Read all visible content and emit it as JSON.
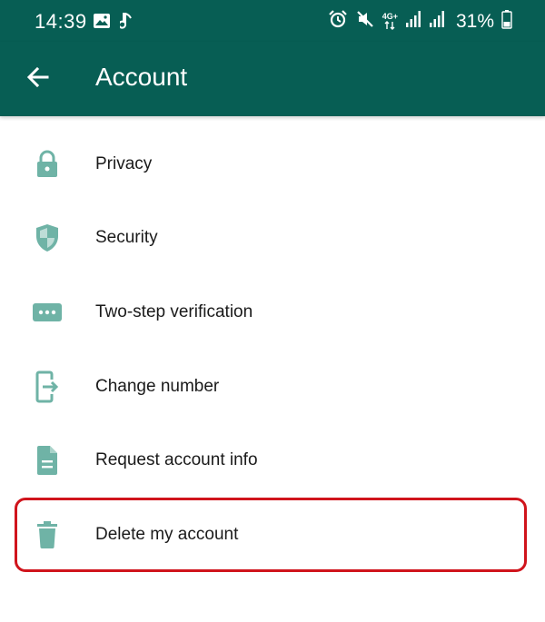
{
  "status_bar": {
    "time": "14:39",
    "network_label": "4G+",
    "battery": "31%",
    "left_icons": [
      "image-icon",
      "music-note-icon"
    ],
    "right_icons": [
      "alarm-icon",
      "mute-icon",
      "network-icon",
      "signal-icon",
      "signal-icon",
      "battery-icon"
    ]
  },
  "app_bar": {
    "title": "Account",
    "back_icon": "arrow-left-icon"
  },
  "colors": {
    "primary_dark": "#075e54",
    "icon_teal": "#6fb3a6",
    "highlight_red": "#d0141c"
  },
  "menu": {
    "items": [
      {
        "label": "Privacy",
        "icon": "lock-icon"
      },
      {
        "label": "Security",
        "icon": "shield-icon"
      },
      {
        "label": "Two-step verification",
        "icon": "dots-icon"
      },
      {
        "label": "Change number",
        "icon": "change-number-icon"
      },
      {
        "label": "Request account info",
        "icon": "document-icon"
      },
      {
        "label": "Delete my account",
        "icon": "trash-icon",
        "highlighted": true
      }
    ]
  }
}
